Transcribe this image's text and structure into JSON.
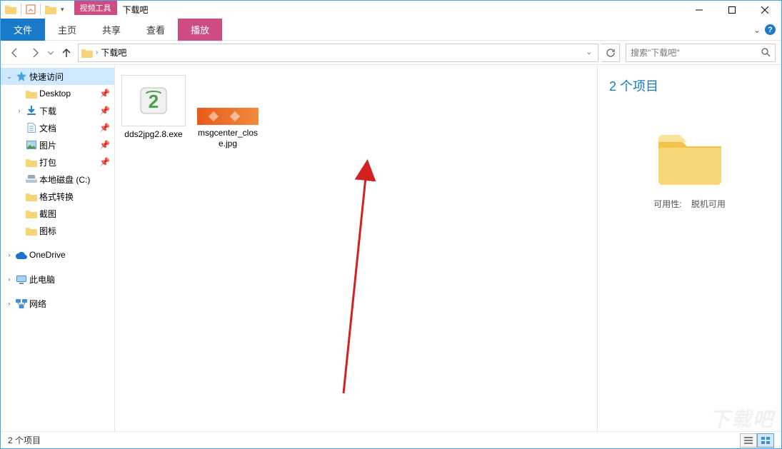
{
  "titleBar": {
    "toolTab": "视频工具",
    "title": "下载吧"
  },
  "ribbon": {
    "file": "文件",
    "home": "主页",
    "share": "共享",
    "view": "查看",
    "play": "播放"
  },
  "breadcrumb": {
    "current": "下载吧"
  },
  "search": {
    "placeholder": "搜索\"下载吧\""
  },
  "navTree": {
    "quickAccess": "快速访问",
    "desktop": "Desktop",
    "downloads": "下载",
    "documents": "文档",
    "pictures": "图片",
    "dabao": "打包",
    "localDiskC": "本地磁盘 (C:)",
    "formatConvert": "格式转换",
    "screenshot": "截图",
    "iconLib": "图标",
    "oneDrive": "OneDrive",
    "thisPC": "此电脑",
    "network": "网络"
  },
  "items": [
    {
      "name": "dds2jpg2.8.exe"
    },
    {
      "name": "msgcenter_close.jpg"
    }
  ],
  "detailsPane": {
    "title": "2 个项目",
    "availabilityLabel": "可用性:",
    "availabilityValue": "脱机可用"
  },
  "statusBar": {
    "itemCount": "2 个项目"
  },
  "watermark": "下载吧"
}
